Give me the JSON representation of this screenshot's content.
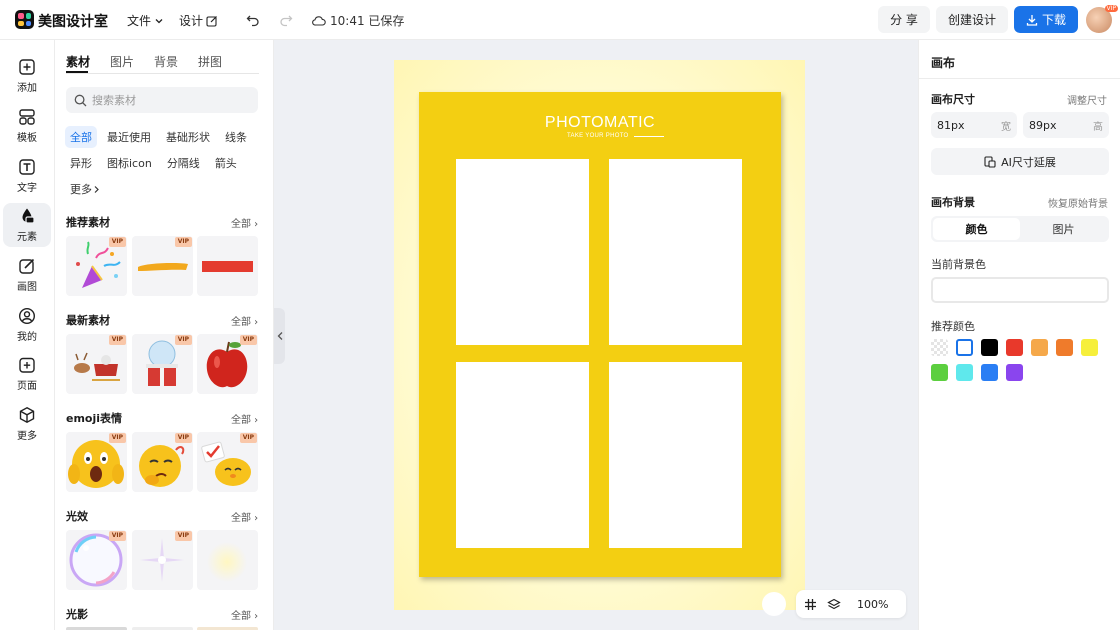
{
  "topbar": {
    "brand": "美图设计室",
    "menu_file": "文件",
    "menu_design": "设计",
    "saved_status": "10:41 已保存",
    "share_label": "分 享",
    "create_label": "创建设计",
    "download_label": "下载",
    "avatar_badge": "VIP"
  },
  "rail": {
    "items": [
      {
        "label": "添加",
        "icon": "plus-square-icon"
      },
      {
        "label": "模板",
        "icon": "layout-icon"
      },
      {
        "label": "文字",
        "icon": "text-icon"
      },
      {
        "label": "元素",
        "icon": "shapes-icon"
      },
      {
        "label": "画图",
        "icon": "edit-icon"
      },
      {
        "label": "我的",
        "icon": "user-icon"
      },
      {
        "label": "页面",
        "icon": "page-add-icon"
      },
      {
        "label": "更多",
        "icon": "cube-icon"
      }
    ],
    "active_index": 3
  },
  "panel": {
    "tabs": [
      "素材",
      "图片",
      "背景",
      "拼图"
    ],
    "search_placeholder": "搜索素材",
    "chips_row1": [
      "全部",
      "最近使用",
      "基础形状",
      "线条"
    ],
    "chips_row2": [
      "异形",
      "图标icon",
      "分隔线",
      "箭头"
    ],
    "more_chip": "更多",
    "see_all": "全部",
    "vip": "VIP",
    "sections": [
      {
        "title": "推荐素材",
        "items": [
          "party-popper",
          "yellow-brush-stroke",
          "red-brush-stroke"
        ]
      },
      {
        "title": "最新素材",
        "items": [
          "reindeer-sleigh",
          "snow-globe-gift",
          "red-apple"
        ]
      },
      {
        "title": "emoji表情",
        "items": [
          "shocked-emoji",
          "thinking-emoji",
          "chick-emoji"
        ]
      },
      {
        "title": "光效",
        "items": [
          "bubble-ring",
          "sparkle-star",
          "soft-glow"
        ]
      },
      {
        "title": "光影",
        "items": []
      }
    ]
  },
  "canvas": {
    "poster_title": "PHOTOMATIC",
    "poster_subtitle": "TAKE YOUR PHOTO",
    "poster_color": "#f3cf12",
    "zoom": "100%"
  },
  "right": {
    "title": "画布",
    "size_label": "画布尺寸",
    "resize_link": "调整尺寸",
    "width_value": "81px",
    "width_unit": "宽",
    "height_value": "89px",
    "height_unit": "高",
    "ai_button": "AI尺寸延展",
    "bg_label": "画布背景",
    "restore_link": "恢复原始背景",
    "seg_color": "颜色",
    "seg_image": "图片",
    "current_bg_label": "当前背景色",
    "recommend_label": "推荐颜色",
    "swatches": [
      "transparent",
      "#ffffff",
      "#000000",
      "#e8392b",
      "#f5a84a",
      "#ef7b2b",
      "#f6ef3b",
      "#5ccf3f",
      "#5fe8ec",
      "#2a7ef4",
      "#8a45ee"
    ]
  }
}
